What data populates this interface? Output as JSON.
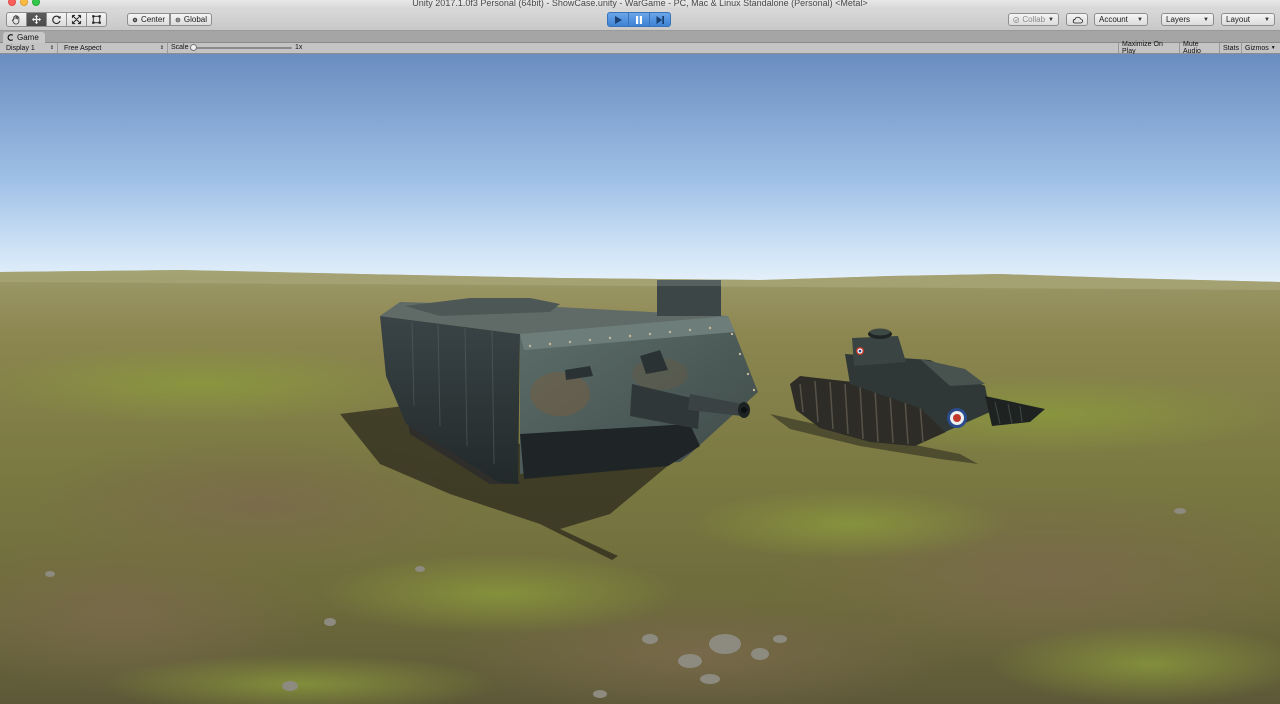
{
  "window": {
    "title": "Unity 2017.1.0f3 Personal (64bit) - ShowCase.unity - WarGame - PC, Mac & Linux Standalone (Personal) <Metal>"
  },
  "toolbar": {
    "transform_tools": [
      "hand-tool-icon",
      "move-tool-icon",
      "rotate-tool-icon",
      "scale-tool-icon",
      "rect-tool-icon"
    ],
    "active_tool": "move-tool-icon",
    "pivot_mode_label": "Center",
    "pivot_rotation_label": "Global",
    "collab_label": "Collab",
    "account_label": "Account",
    "layers_label": "Layers",
    "layout_label": "Layout"
  },
  "tab": {
    "label": "Game"
  },
  "game_toolbar": {
    "display_label": "Display 1",
    "aspect_label": "Free Aspect",
    "scale_label": "Scale",
    "scale_value": "1x",
    "maximize_label": "Maximize On Play",
    "mute_label": "Mute Audio",
    "stats_label": "Stats",
    "gizmos_label": "Gizmos"
  },
  "colors": {
    "play_accent": "#3e82d4",
    "sky_top": "#6a8dc0",
    "sky_horizon": "#dfeefb",
    "ground": "#7c7a46"
  }
}
